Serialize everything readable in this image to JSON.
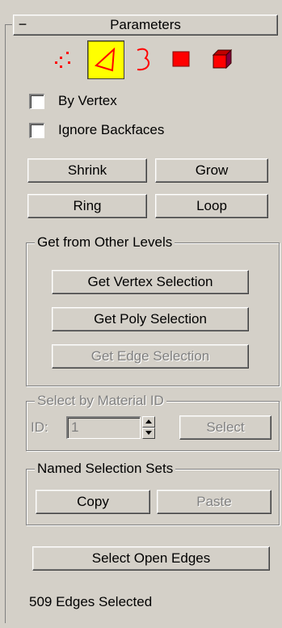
{
  "rollout": {
    "collapse_symbol": "−",
    "title": "Parameters"
  },
  "subobject_modes": [
    {
      "name": "vertex",
      "icon": "vertex-dots-icon",
      "color": "#ff0000",
      "active": false
    },
    {
      "name": "edge",
      "icon": "edge-triangle-icon",
      "color": "#ff0000",
      "active": true
    },
    {
      "name": "border",
      "icon": "border-loop-icon",
      "color": "#ff0000",
      "active": false
    },
    {
      "name": "polygon",
      "icon": "polygon-square-icon",
      "color": "#ff0000",
      "active": false
    },
    {
      "name": "element",
      "icon": "element-cube-icon",
      "color": "#ff0000",
      "active": false
    }
  ],
  "options": {
    "by_vertex": {
      "label": "By Vertex",
      "checked": false
    },
    "ignore_backfaces": {
      "label": "Ignore Backfaces",
      "checked": false
    }
  },
  "selection_buttons": {
    "shrink": "Shrink",
    "grow": "Grow",
    "ring": "Ring",
    "loop": "Loop"
  },
  "get_from_levels": {
    "title": "Get from Other Levels",
    "get_vertex": "Get Vertex Selection",
    "get_poly": "Get Poly Selection",
    "get_edge": "Get Edge Selection"
  },
  "material_id": {
    "title": "Select by Material ID",
    "id_label": "ID:",
    "id_value": "1",
    "select_label": "Select",
    "enabled": false
  },
  "named_sets": {
    "title": "Named Selection Sets",
    "copy": "Copy",
    "paste": "Paste"
  },
  "select_open_edges": "Select Open Edges",
  "status": "509 Edges Selected",
  "colors": {
    "panel_bg": "#d4d0c8",
    "active_highlight": "#ffff00",
    "icon_red": "#ff0000",
    "disabled_text": "#808080"
  }
}
